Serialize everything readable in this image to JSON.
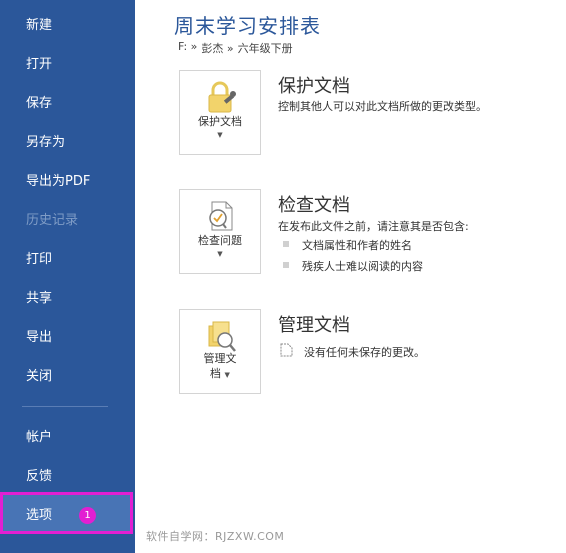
{
  "sidebar": {
    "items": [
      {
        "label": "新建"
      },
      {
        "label": "打开"
      },
      {
        "label": "保存"
      },
      {
        "label": "另存为"
      },
      {
        "label": "导出为PDF"
      },
      {
        "label": "历史记录"
      },
      {
        "label": "打印"
      },
      {
        "label": "共享"
      },
      {
        "label": "导出"
      },
      {
        "label": "关闭"
      },
      {
        "label": "帐户"
      },
      {
        "label": "反馈"
      },
      {
        "label": "选项"
      }
    ],
    "options_badge": "1"
  },
  "main": {
    "title": "周末学习安排表",
    "breadcrumb": [
      "F: »",
      "彭杰 »",
      "六年级下册"
    ],
    "sections": [
      {
        "tile_label": "保护文档",
        "title": "保护文档",
        "description": "控制其他人可以对此文档所做的更改类型。"
      },
      {
        "tile_label": "检查问题",
        "title": "检查文档",
        "description": "在发布此文件之前，请注意其是否包含:",
        "bullets": [
          "文档属性和作者的姓名",
          "残疾人士难以阅读的内容"
        ]
      },
      {
        "tile_label_line1": "管理文",
        "tile_label_line2": "档",
        "title": "管理文档",
        "description": "没有任何未保存的更改。"
      }
    ]
  },
  "watermark": "软件自学网：RJZXW.COM",
  "colors": {
    "sidebar": "#2b579a",
    "accent": "#2b579a",
    "highlight": "#e21fd2"
  }
}
